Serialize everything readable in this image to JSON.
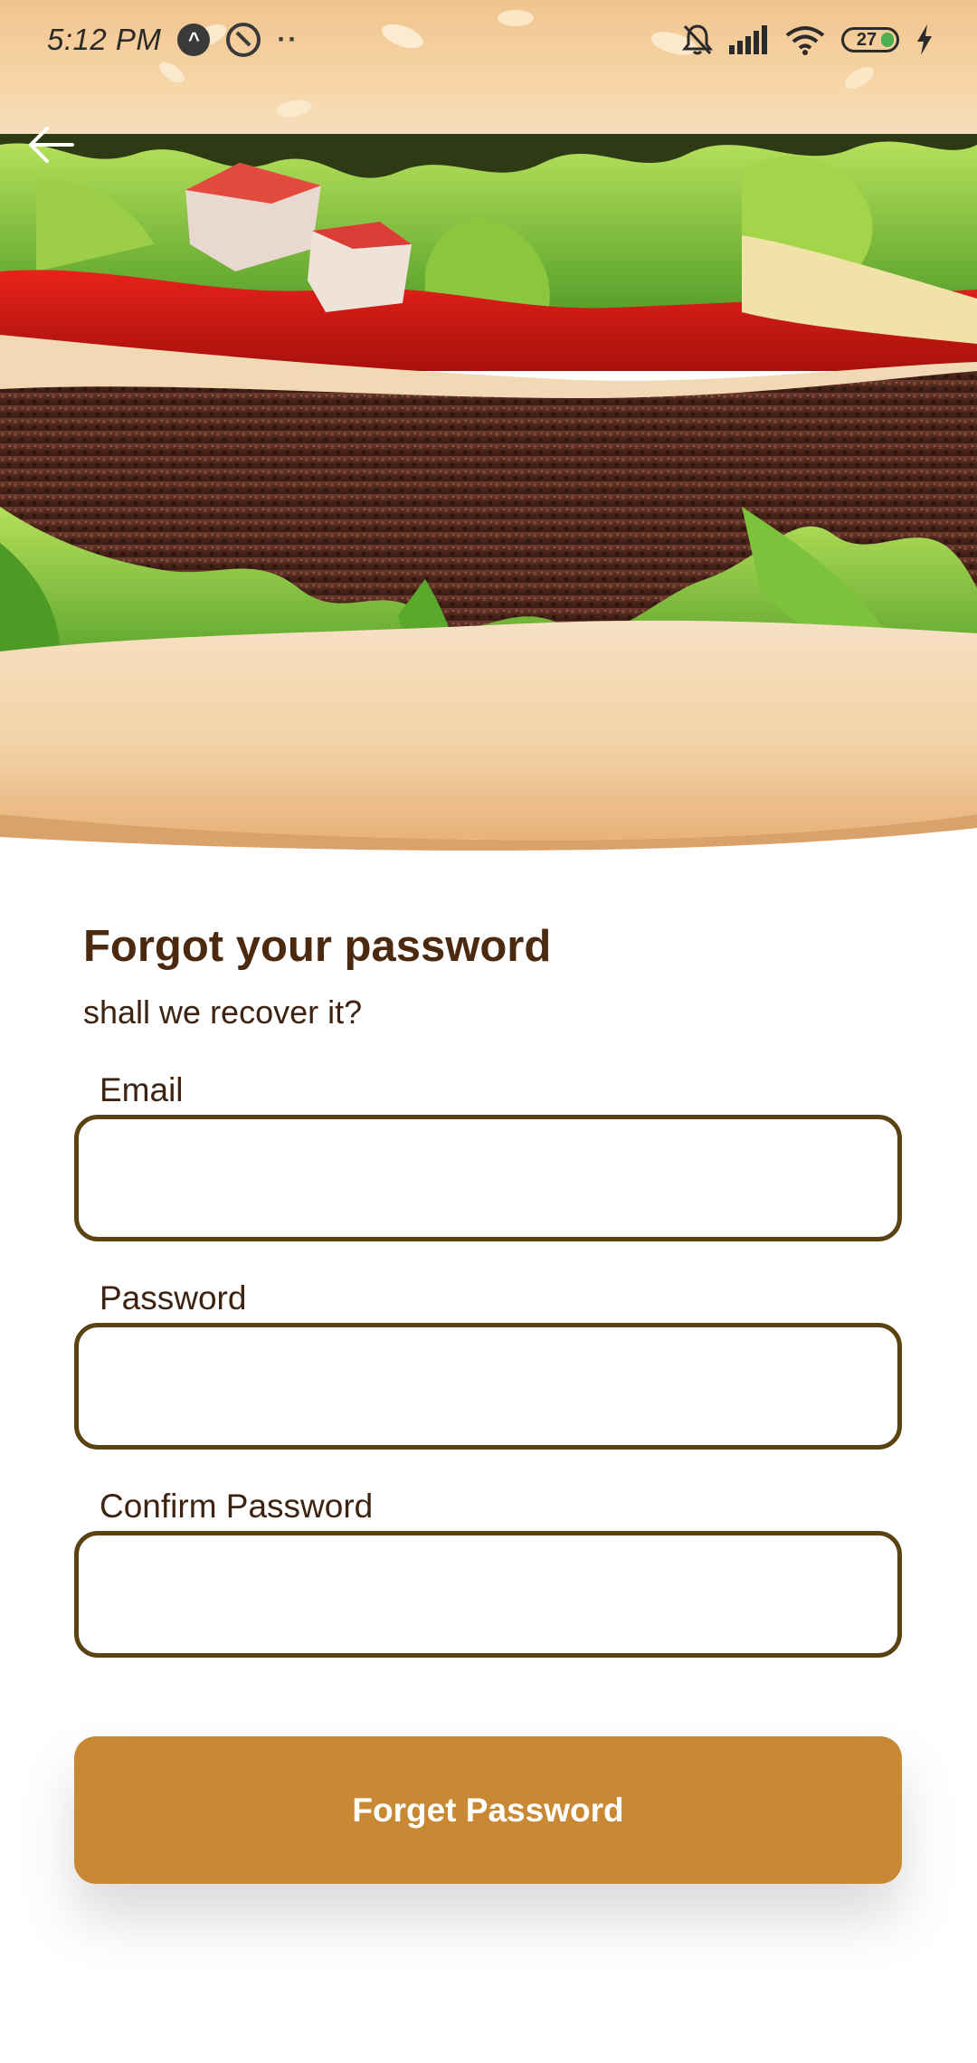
{
  "status_bar": {
    "time": "5:12 PM",
    "battery_level": "27",
    "icons": [
      "nav-arrow-icon",
      "do-not-disturb-icon",
      "more-dots-icon",
      "bell-off-icon",
      "cellular-signal-icon",
      "wifi-icon",
      "battery-icon",
      "charging-icon"
    ]
  },
  "header": {
    "back_icon": "arrow-left-icon",
    "hero_image": "burger-photo"
  },
  "form": {
    "title": "Forgot your password",
    "subtitle": "shall we recover it?",
    "email_label": "Email",
    "email_value": "",
    "password_label": "Password",
    "password_value": "",
    "confirm_label": "Confirm Password",
    "confirm_value": "",
    "submit_label": "Forget Password"
  },
  "colors": {
    "title_text": "#4b2a10",
    "input_border": "#5a4310",
    "button_bg": "#c98834",
    "button_text": "#ffffff",
    "background": "#ffffff"
  }
}
